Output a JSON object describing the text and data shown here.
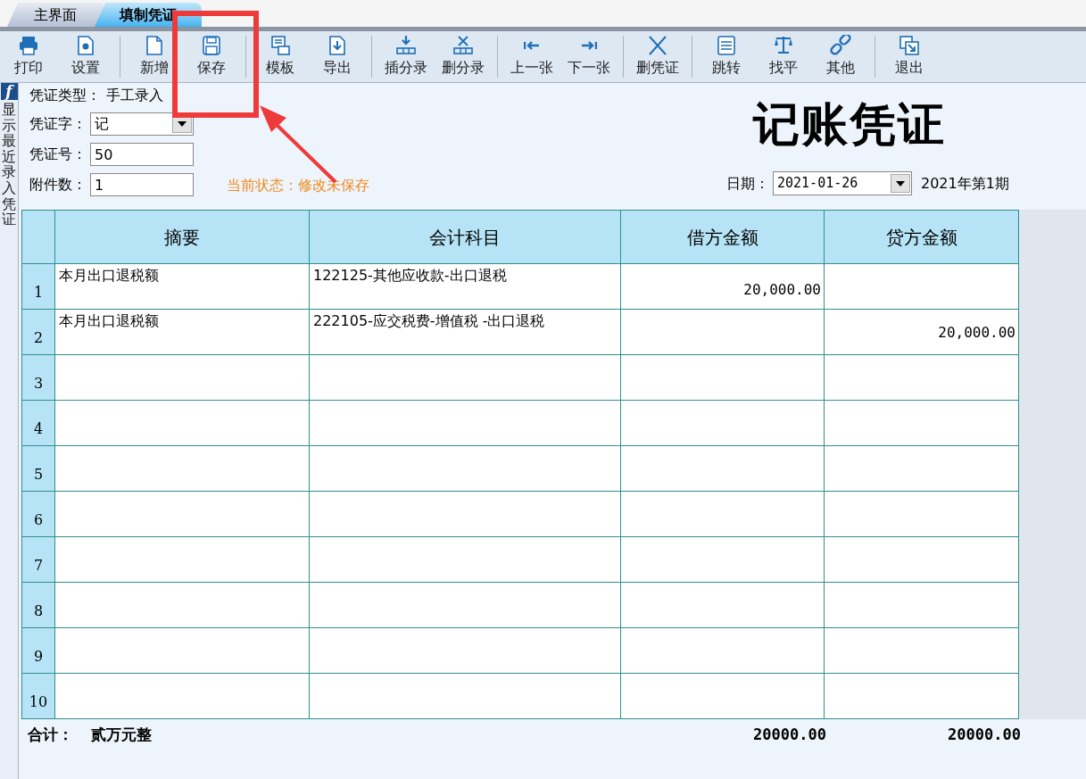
{
  "tabs": [
    {
      "label": "主界面",
      "selected": false
    },
    {
      "label": "填制凭证",
      "selected": true
    }
  ],
  "toolbar_groups": [
    [
      "打印",
      "设置"
    ],
    [
      "新增",
      "保存"
    ],
    [
      "模板",
      "导出"
    ],
    [
      "插分录",
      "删分录"
    ],
    [
      "上一张",
      "下一张"
    ],
    [
      "删凭证"
    ],
    [
      "跳转",
      "找平",
      "其他"
    ],
    [
      "退出"
    ]
  ],
  "side_panel": {
    "icon_letter": "f",
    "label": "显示最近录入凭证"
  },
  "form": {
    "type_label": "凭证类型：",
    "type_value": "手工录入",
    "fields": [
      {
        "label": "凭证字：",
        "value": "记",
        "kind": "dropdown"
      },
      {
        "label": "凭证号：",
        "value": "50",
        "kind": "text"
      },
      {
        "label": "附件数：",
        "value": "1",
        "kind": "text"
      }
    ],
    "status": "当前状态：修改未保存",
    "title": "记账凭证",
    "date_label": "日期：",
    "date": "2021-01-26",
    "period": "2021年第1期"
  },
  "table": {
    "columns": [
      "摘要",
      "会计科目",
      "借方金额",
      "贷方金额"
    ],
    "rows": [
      {
        "num": "1",
        "summary": "本月出口退税额",
        "account": "122125-其他应收款-出口退税",
        "debit": "20,000.00"
      },
      {
        "num": "2",
        "summary": "本月出口退税额",
        "account": "222105-应交税费-增值税 -出口退税",
        "credit": "20,000.00"
      },
      {
        "num": "3"
      },
      {
        "num": "4"
      },
      {
        "num": "5"
      },
      {
        "num": "6"
      },
      {
        "num": "7"
      },
      {
        "num": "8"
      },
      {
        "num": "9"
      },
      {
        "num": "10"
      }
    ]
  },
  "totals": {
    "label": "合计：",
    "words": "贰万元整",
    "debit": "20000.00",
    "credit": "20000.00"
  }
}
